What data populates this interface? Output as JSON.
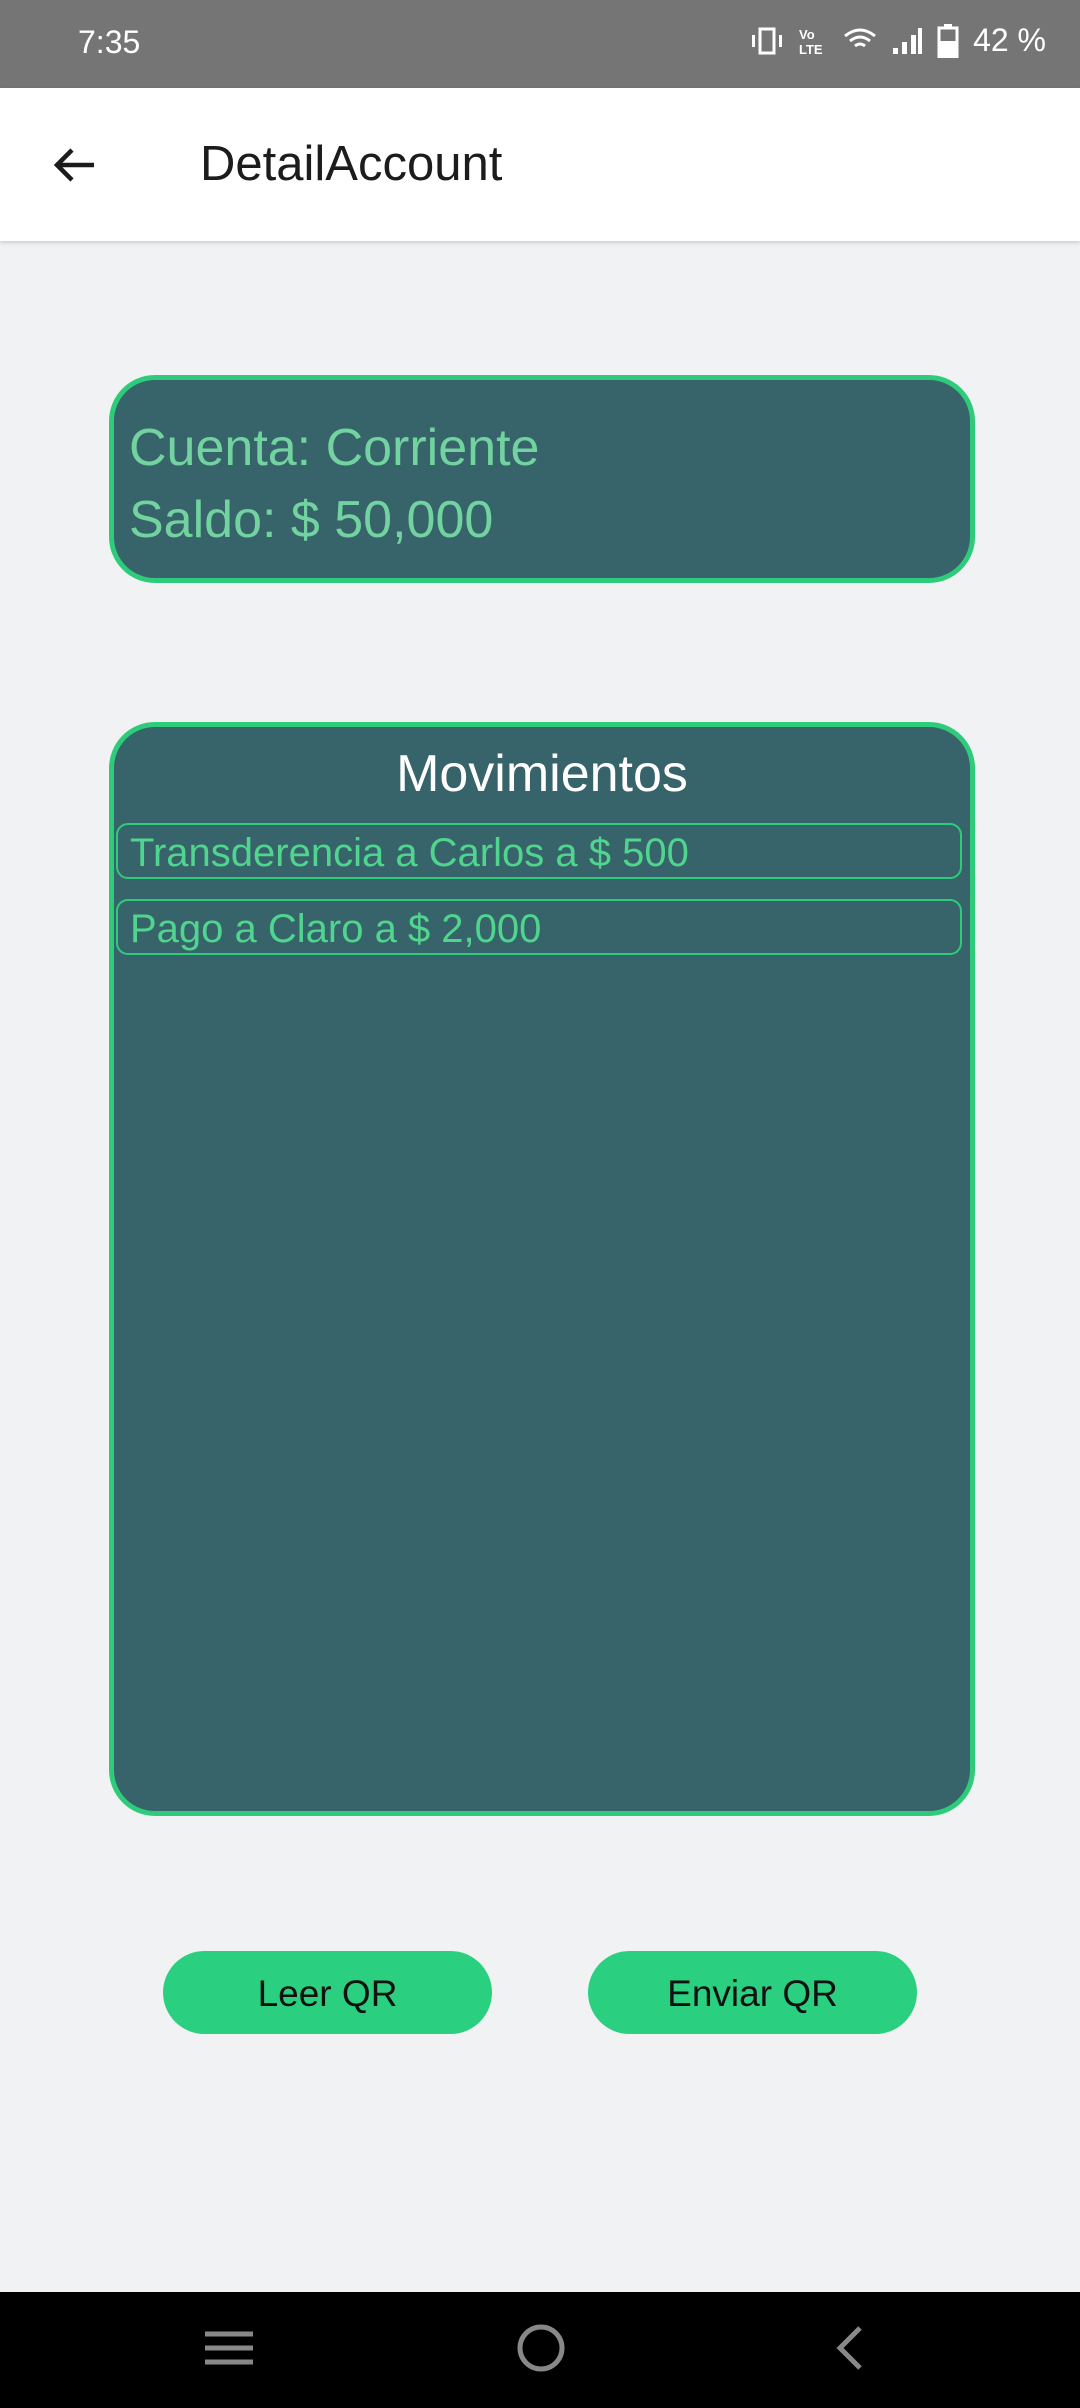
{
  "status_bar": {
    "time": "7:35",
    "battery": "42 %",
    "icons": [
      "vibrate-icon",
      "volte-icon",
      "wifi-icon",
      "signal-icon",
      "battery-icon"
    ]
  },
  "app_bar": {
    "title": "DetailAccount",
    "back_icon": "arrow-left-icon"
  },
  "account": {
    "type_line": "Cuenta: Corriente",
    "balance_line": "Saldo: $ 50,000"
  },
  "movements": {
    "title": "Movimientos",
    "items": [
      "Transderencia a Carlos  a $ 500",
      "Pago a Claro  a $ 2,000"
    ]
  },
  "buttons": {
    "read_qr": "Leer QR",
    "send_qr": "Enviar QR"
  },
  "colors": {
    "accent": "#2ad07f",
    "card": "#37636a",
    "card_text": "#72d3a0"
  }
}
